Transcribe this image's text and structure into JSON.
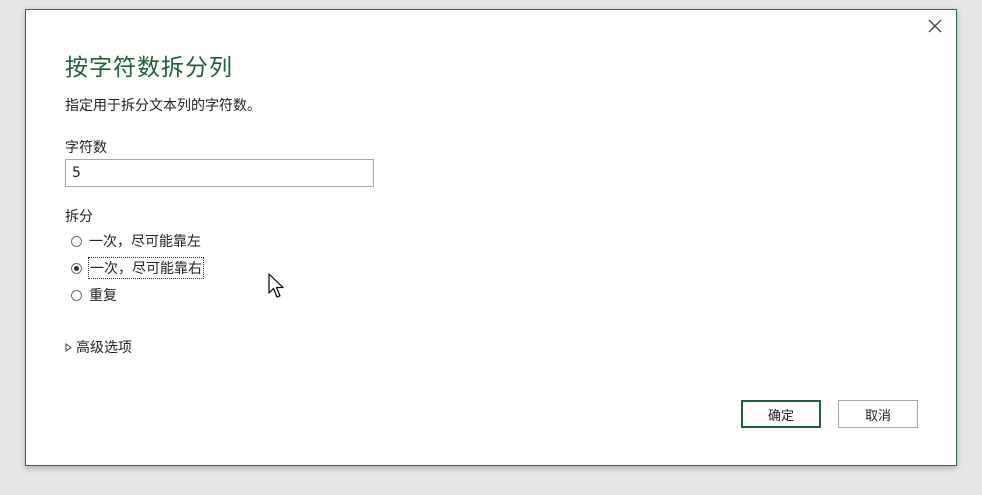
{
  "dialog": {
    "title": "按字符数拆分列",
    "description": "指定用于拆分文本列的字符数。",
    "close_icon": "close-icon"
  },
  "char_count": {
    "label": "字符数",
    "value": "5"
  },
  "split": {
    "label": "拆分",
    "options": [
      {
        "label": "一次，尽可能靠左",
        "selected": false
      },
      {
        "label": "一次，尽可能靠右",
        "selected": true
      },
      {
        "label": "重复",
        "selected": false
      }
    ]
  },
  "advanced": {
    "label": "高级选项",
    "icon": "triangle-right-icon"
  },
  "buttons": {
    "ok": "确定",
    "cancel": "取消"
  },
  "colors": {
    "accent": "#1e5e38",
    "border": "#217346"
  }
}
